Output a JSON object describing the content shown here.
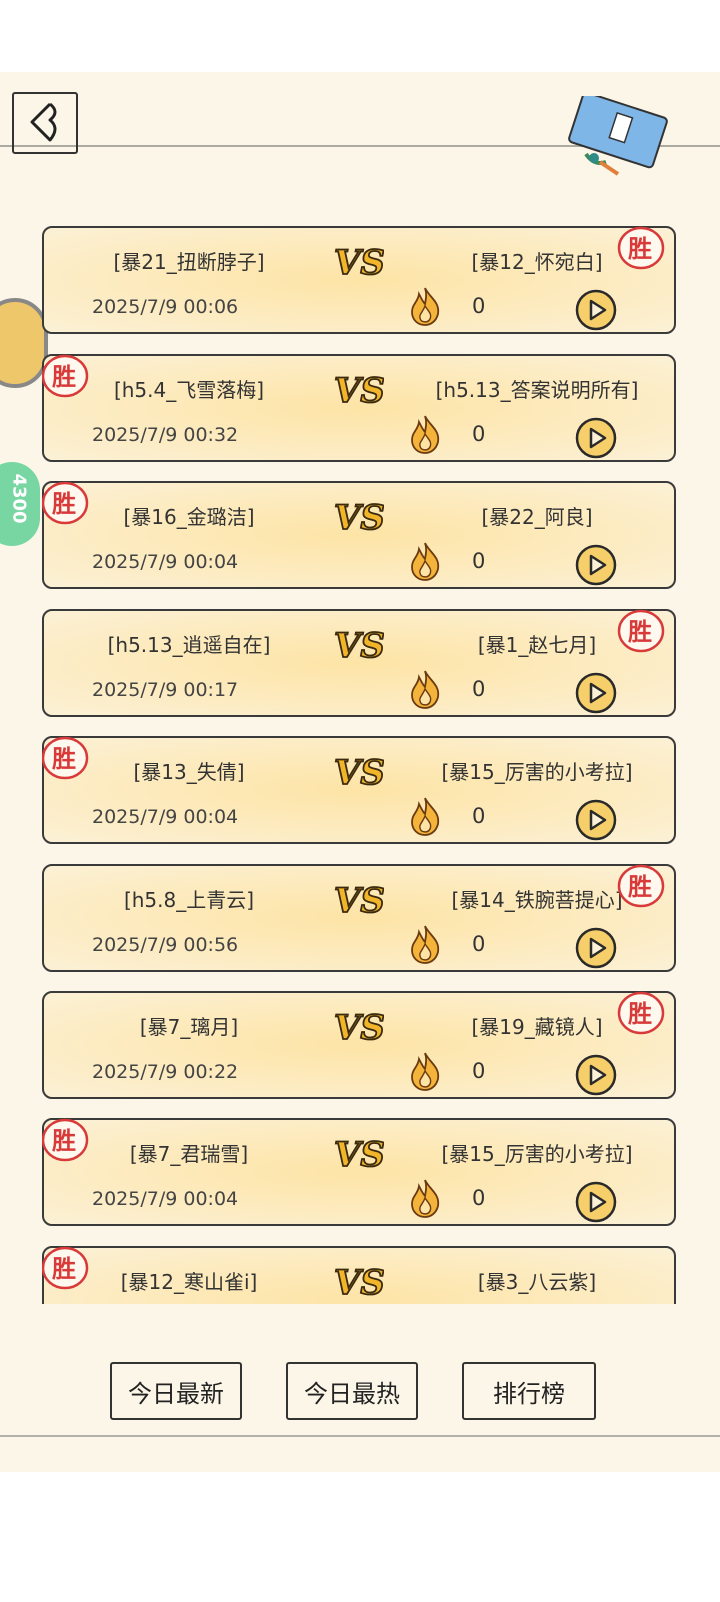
{
  "colors": {
    "paper": "#fbf6e7",
    "card_fill": "#fde4a6",
    "win_red": "#d83a3a",
    "fire": "#e9a31a"
  },
  "header": {
    "back_icon": "chevron-left-icon",
    "book_icon": "book-icon"
  },
  "matches": [
    {
      "left": "[暴21_扭断脖子]",
      "right": "[暴12_怀宛白]",
      "time": "2025/7/9 00:06",
      "hot": "0",
      "winner": "right"
    },
    {
      "left": "[h5.4_飞雪落梅]",
      "right": "[h5.13_答案说明所有]",
      "time": "2025/7/9 00:32",
      "hot": "0",
      "winner": "left"
    },
    {
      "left": "[暴16_金璐洁]",
      "right": "[暴22_阿良]",
      "time": "2025/7/9 00:04",
      "hot": "0",
      "winner": "left"
    },
    {
      "left": "[h5.13_逍遥自在]",
      "right": "[暴1_赵七月]",
      "time": "2025/7/9 00:17",
      "hot": "0",
      "winner": "right"
    },
    {
      "left": "[暴13_失倩]",
      "right": "[暴15_厉害的小考拉]",
      "time": "2025/7/9 00:04",
      "hot": "0",
      "winner": "left"
    },
    {
      "left": "[h5.8_上青云]",
      "right": "[暴14_铁腕菩提心]",
      "time": "2025/7/9 00:56",
      "hot": "0",
      "winner": "right"
    },
    {
      "left": "[暴7_璃月]",
      "right": "[暴19_藏镜人]",
      "time": "2025/7/9 00:22",
      "hot": "0",
      "winner": "right"
    },
    {
      "left": "[暴7_君瑞雪]",
      "right": "[暴15_厉害的小考拉]",
      "time": "2025/7/9 00:04",
      "hot": "0",
      "winner": "left"
    },
    {
      "left": "[暴12_寒山雀i]",
      "right": "[暴3_八云紫]",
      "time": "",
      "hot": "",
      "winner": "left"
    }
  ],
  "labels": {
    "vs": "VS",
    "win": "胜"
  },
  "side": {
    "badge_text": "4300"
  },
  "tabs": {
    "latest": "今日最新",
    "hottest": "今日最热",
    "ranking": "排行榜"
  }
}
